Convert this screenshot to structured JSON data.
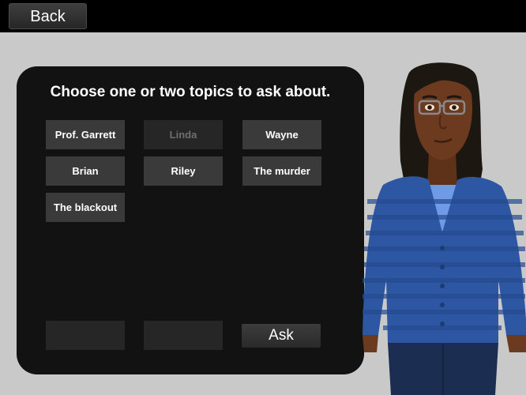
{
  "nav": {
    "back_label": "Back"
  },
  "panel": {
    "title": "Choose one or two topics to ask about.",
    "topics": [
      {
        "label": "Prof. Garrett",
        "enabled": true
      },
      {
        "label": "Linda",
        "enabled": false
      },
      {
        "label": "Wayne",
        "enabled": true
      },
      {
        "label": "Brian",
        "enabled": true
      },
      {
        "label": "Riley",
        "enabled": true
      },
      {
        "label": "The murder",
        "enabled": true
      },
      {
        "label": "The blackout",
        "enabled": true
      }
    ],
    "selected_slots": [
      "",
      ""
    ],
    "ask_label": "Ask"
  },
  "colors": {
    "background": "#c9c9c9",
    "topbar": "#000000",
    "panel": "#121212",
    "topic_button": "#3a3a3a",
    "topic_disabled": "#262626",
    "sweater": "#2d57a3",
    "undershirt": "#6f9be6",
    "skin": "#6b3a1f",
    "hair": "#1d1712"
  },
  "character": {
    "icon": "character-portrait"
  }
}
